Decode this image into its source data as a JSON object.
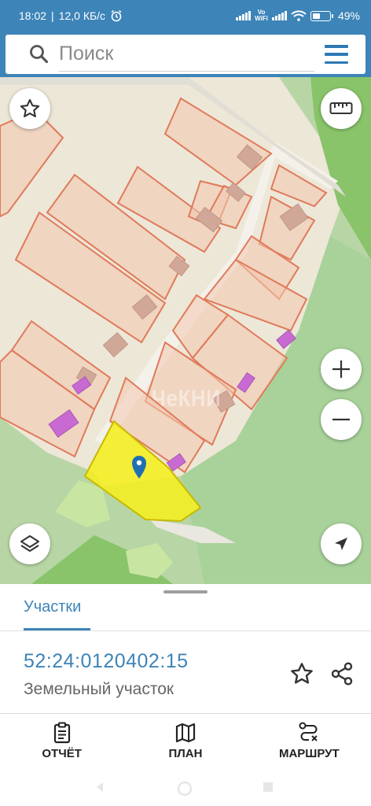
{
  "status_bar": {
    "time": "18:02",
    "speed": "12,0 КБ/с",
    "volte_top": "Vo",
    "volte_bottom": "WiFi",
    "battery": "49%",
    "battery_level": 0.49
  },
  "search": {
    "placeholder": "Поиск",
    "value": ""
  },
  "map": {
    "watermark": "ЧеКНИ",
    "selected_parcel_color": "#f4ee25",
    "marker_color": "#1f6fb3"
  },
  "sheet": {
    "tab_label": "Участки",
    "cadastral_number": "52:24:0120402:15",
    "parcel_type": "Земельный участок"
  },
  "actions": [
    {
      "label": "ОТЧЁТ",
      "icon": "report-icon"
    },
    {
      "label": "ПЛАН",
      "icon": "map-plan-icon"
    },
    {
      "label": "МАРШРУТ",
      "icon": "route-icon"
    }
  ],
  "colors": {
    "accent": "#3d84b8",
    "parcel_outline": "#e07a5a",
    "building": "#d1a898",
    "purple_building": "#c86ad2"
  }
}
